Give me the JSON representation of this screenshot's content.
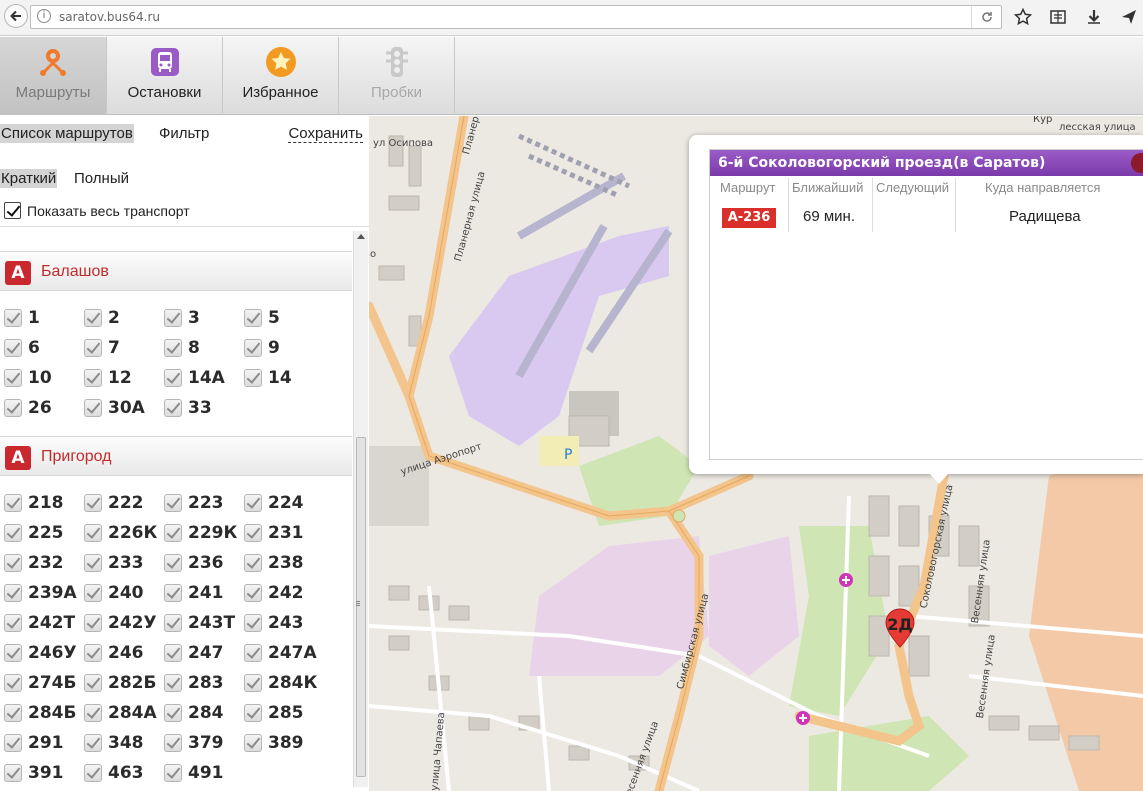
{
  "browser": {
    "url": "saratov.bus64.ru",
    "icons": [
      "back-arrow-icon",
      "info-icon",
      "reload-icon",
      "star-icon",
      "reading-list-icon",
      "download-icon",
      "share-icon"
    ]
  },
  "nav": {
    "tabs": [
      {
        "label": "Маршруты",
        "icon": "route-pin-icon",
        "state": "active"
      },
      {
        "label": "Остановки",
        "icon": "bus-stop-icon",
        "state": "normal"
      },
      {
        "label": "Избранное",
        "icon": "star-icon",
        "state": "normal"
      },
      {
        "label": "Пробки",
        "icon": "traffic-light-icon",
        "state": "disabled"
      }
    ]
  },
  "sidebar": {
    "subtabs": {
      "list": "Список маршрутов",
      "filter": "Фильтр",
      "save": "Сохранить"
    },
    "view_modes": {
      "short": "Краткий",
      "full": "Полный"
    },
    "show_all": "Показать весь транспорт",
    "groups": [
      {
        "badge": "А",
        "name": "Балашов",
        "routes": [
          "1",
          "2",
          "3",
          "5",
          "6",
          "7",
          "8",
          "9",
          "10",
          "12",
          "14А",
          "14",
          "26",
          "30А",
          "33"
        ]
      },
      {
        "badge": "А",
        "name": "Пригород",
        "routes": [
          "218",
          "222",
          "223",
          "224",
          "225",
          "226К",
          "229К",
          "231",
          "232",
          "233",
          "236",
          "238",
          "239А",
          "240",
          "241",
          "242",
          "242Т",
          "242У",
          "243Т",
          "243",
          "246У",
          "246",
          "247",
          "247А",
          "274Б",
          "282Б",
          "283",
          "284К",
          "284Б",
          "284А",
          "284",
          "285",
          "291",
          "348",
          "379",
          "389",
          "391",
          "463",
          "491"
        ]
      }
    ]
  },
  "popup": {
    "title": "6-й Соколовогорский проезд(в Саратов)",
    "columns": {
      "route": "Маршрут",
      "nearest": "Ближайший",
      "next": "Следующий",
      "direction": "Куда направляется"
    },
    "rows": [
      {
        "route": "А-236",
        "nearest": "69 мин.",
        "next": "",
        "direction": "Радищева"
      }
    ]
  },
  "map": {
    "stop_marker": "2Д",
    "parking": "P",
    "street_labels": {
      "osipova": "ул Осипова",
      "planernaya": "Планерная улица",
      "planer_top": "Планер",
      "aeroport": "улица Аэропорт",
      "simbirskaya": "Симбирская улица",
      "sokolovogorskaya": "Соколовогорская улица",
      "vesennyaya": "Весенняя улица",
      "vesennyaya2": "Весенняя улица",
      "chapaeva": "улица Чапаева",
      "vesennyaya_bottom": "Весенняя улица",
      "kurskaya": "Кур",
      "leskaya": "лесская улица",
      "o_label": "о"
    },
    "colors": {
      "route_road": "#f6c98e",
      "airport": "#d9c8f0",
      "park": "#cfe6b4",
      "industrial": "#e9d3e9",
      "residential": "#f3c9a8"
    }
  }
}
